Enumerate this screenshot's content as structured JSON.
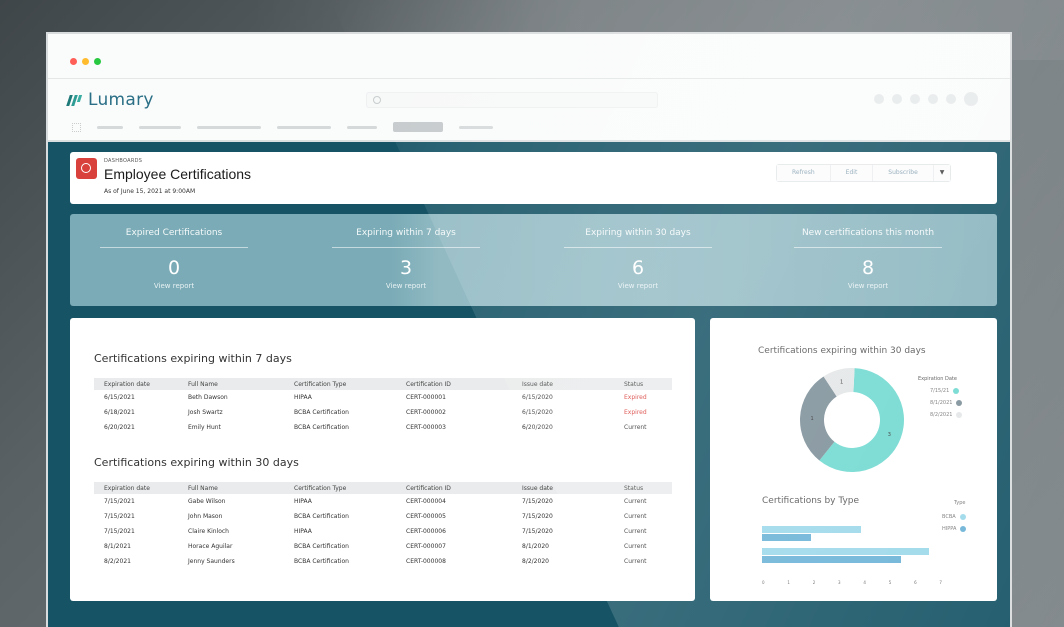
{
  "app": {
    "name": "Lumary",
    "window_dots": [
      "#ff5f57",
      "#febc2e",
      "#28c840"
    ]
  },
  "header": {
    "breadcrumb": "DASHBOARDS",
    "title": "Employee Certifications",
    "as_of": "As of June 15, 2021 at 9:00AM",
    "buttons": [
      "Refresh",
      "Edit",
      "Subscribe"
    ]
  },
  "kpis": [
    {
      "label": "Expired Certifications",
      "value": "0",
      "link": "View report"
    },
    {
      "label": "Expiring within 7 days",
      "value": "3",
      "link": "View report"
    },
    {
      "label": "Expiring within 30 days",
      "value": "6",
      "link": "View report"
    },
    {
      "label": "New certifications this month",
      "value": "8",
      "link": "View report"
    }
  ],
  "table7": {
    "title": "Certifications expiring within 7 days",
    "columns": [
      "Expiration date",
      "Full Name",
      "Certification Type",
      "Certification ID",
      "Issue date",
      "Status"
    ],
    "rows": [
      {
        "exp": "6/15/2021",
        "name": "Beth Dawson",
        "type": "HIPAA",
        "cid": "CERT-000001",
        "issue": "6/15/2020",
        "status": "Expired",
        "expired": true
      },
      {
        "exp": "6/18/2021",
        "name": "Josh Swartz",
        "type": "BCBA Certification",
        "cid": "CERT-000002",
        "issue": "6/15/2020",
        "status": "Expired",
        "expired": true
      },
      {
        "exp": "6/20/2021",
        "name": "Emily Hunt",
        "type": "BCBA Certification",
        "cid": "CERT-000003",
        "issue": "6/20/2020",
        "status": "Current",
        "expired": false
      }
    ]
  },
  "table30": {
    "title": "Certifications expiring within 30 days",
    "columns": [
      "Expiration date",
      "Full Name",
      "Certification Type",
      "Certification ID",
      "Issue date",
      "Status"
    ],
    "rows": [
      {
        "exp": "7/15/2021",
        "name": "Gabe Wilson",
        "type": "HIPAA",
        "cid": "CERT-000004",
        "issue": "7/15/2020",
        "status": "Current"
      },
      {
        "exp": "7/15/2021",
        "name": "John Mason",
        "type": "BCBA Certification",
        "cid": "CERT-000005",
        "issue": "7/15/2020",
        "status": "Current"
      },
      {
        "exp": "7/15/2021",
        "name": "Claire Kinloch",
        "type": "HIPAA",
        "cid": "CERT-000006",
        "issue": "7/15/2020",
        "status": "Current"
      },
      {
        "exp": "8/1/2021",
        "name": "Horace Aguilar",
        "type": "BCBA Certification",
        "cid": "CERT-000007",
        "issue": "8/1/2020",
        "status": "Current"
      },
      {
        "exp": "8/2/2021",
        "name": "Jenny Saunders",
        "type": "BCBA Certification",
        "cid": "CERT-000008",
        "issue": "8/2/2020",
        "status": "Current"
      }
    ]
  },
  "donut": {
    "title": "Certifications expiring within 30 days",
    "legend_title": "Expiration Date",
    "legend": [
      {
        "label": "7/15/21",
        "color": "#6fd9d0"
      },
      {
        "label": "8/1/2021",
        "color": "#7d8f98"
      },
      {
        "label": "8/2/2021",
        "color": "#e3e6e7"
      }
    ],
    "segments": [
      {
        "value": 3,
        "color": "#6fd9d0",
        "label": "3"
      },
      {
        "value": 1.5,
        "color": "#7d8f98",
        "label": "1"
      },
      {
        "value": 0.5,
        "color": "#e3e6e7",
        "label": "1"
      }
    ]
  },
  "bars": {
    "title": "Certifications by Type",
    "legend_title": "Type",
    "legend": [
      {
        "label": "BCBA",
        "color": "#9bd8ea"
      },
      {
        "label": "HIPPA",
        "color": "#6ab2d6"
      }
    ],
    "ticks": [
      "0",
      "1",
      "2",
      "3",
      "4",
      "5",
      "6",
      "7"
    ],
    "rows": [
      {
        "top": 0.55,
        "bottom": 0.27
      },
      {
        "top": 0.93,
        "bottom": 0.77
      }
    ]
  }
}
